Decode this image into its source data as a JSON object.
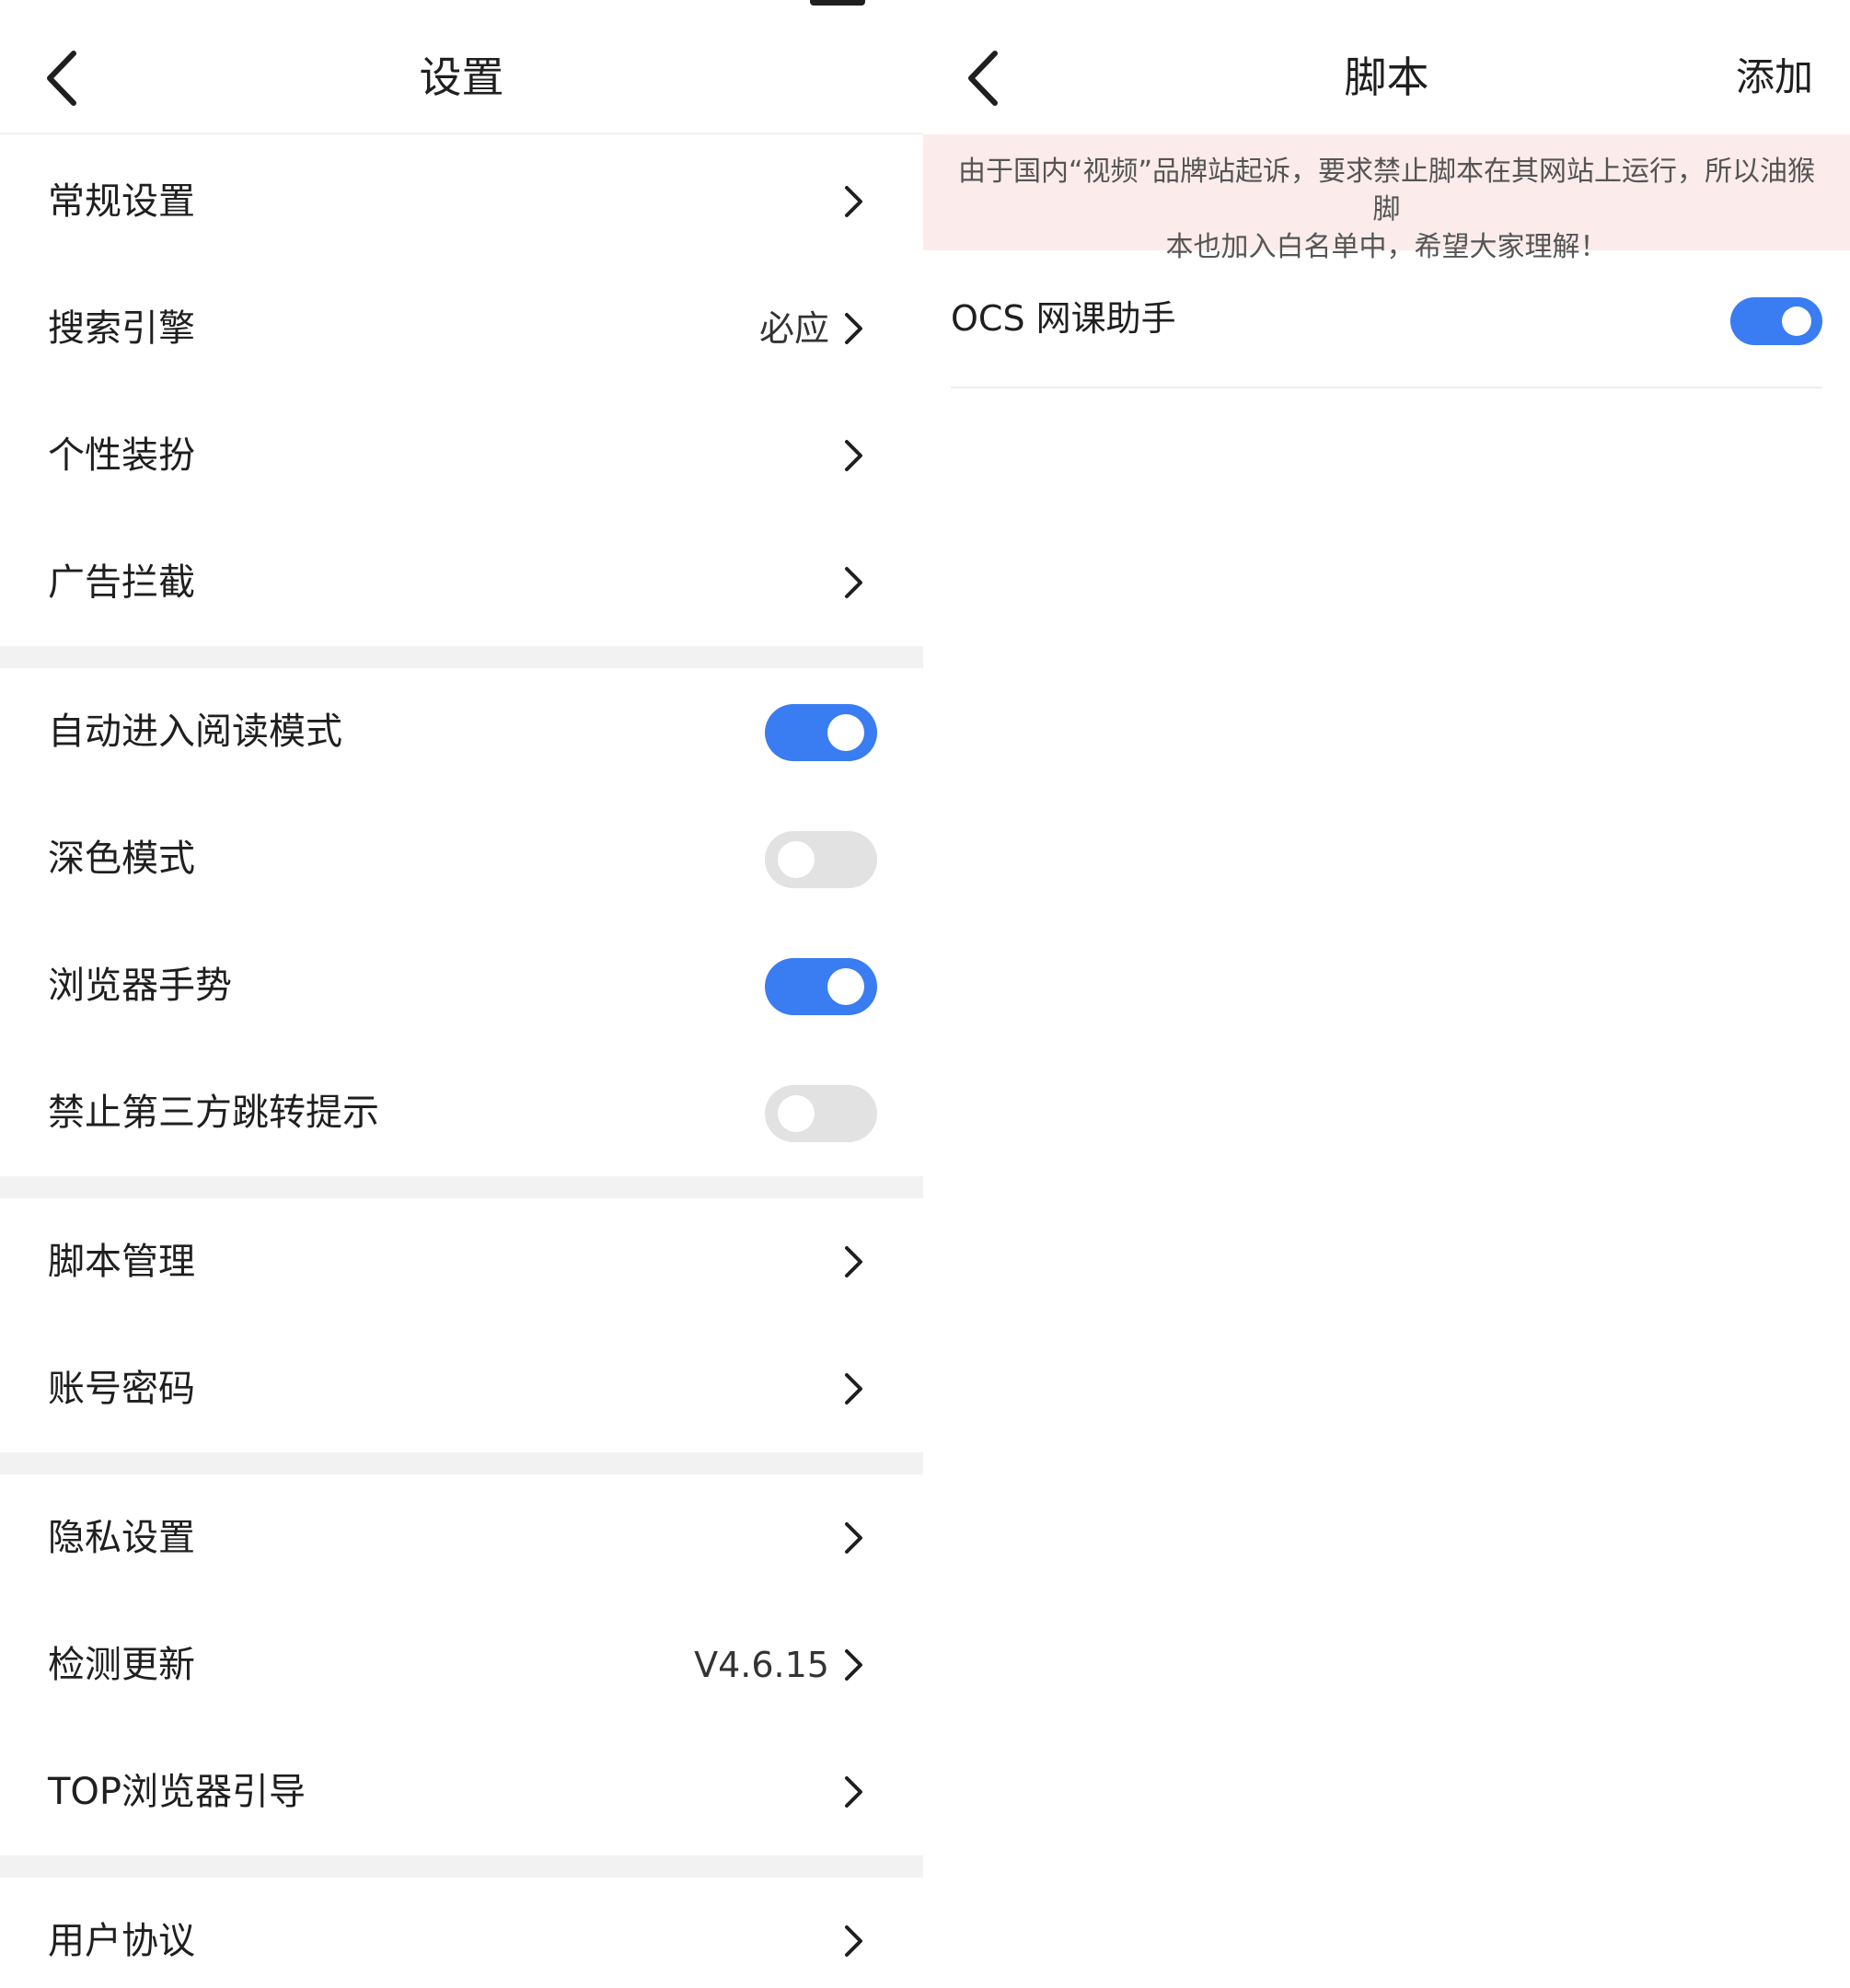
{
  "settings": {
    "title": "设置",
    "groups": [
      [
        {
          "label": "常规设置",
          "type": "nav"
        },
        {
          "label": "搜索引擎",
          "type": "nav",
          "value": "必应"
        },
        {
          "label": "个性装扮",
          "type": "nav"
        },
        {
          "label": "广告拦截",
          "type": "nav"
        }
      ],
      [
        {
          "label": "自动进入阅读模式",
          "type": "toggle",
          "on": true
        },
        {
          "label": "深色模式",
          "type": "toggle",
          "on": false
        },
        {
          "label": "浏览器手势",
          "type": "toggle",
          "on": true
        },
        {
          "label": "禁止第三方跳转提示",
          "type": "toggle",
          "on": false
        }
      ],
      [
        {
          "label": "脚本管理",
          "type": "nav"
        },
        {
          "label": "账号密码",
          "type": "nav"
        }
      ],
      [
        {
          "label": "隐私设置",
          "type": "nav"
        },
        {
          "label": "检测更新",
          "type": "nav",
          "value": "V4.6.15"
        },
        {
          "label": "TOP浏览器引导",
          "type": "nav"
        }
      ],
      [
        {
          "label": "用户协议",
          "type": "nav"
        }
      ]
    ]
  },
  "scripts": {
    "title": "脚本",
    "add_label": "添加",
    "notice_line1": "由于国内“视频”品牌站起诉，要求禁止脚本在其网站上运行，所以油猴脚",
    "notice_line2": "本也加入白名单中，希望大家理解！",
    "items": [
      {
        "name": "OCS 网课助手",
        "enabled": true
      }
    ]
  },
  "icons": {
    "back": "chevron-left-icon",
    "forward": "chevron-right-icon"
  },
  "colors": {
    "accent": "#3a7cf2",
    "toggle_off": "#e2e2e2",
    "notice_bg": "#fbeceb",
    "section_gap": "#f2f2f2"
  }
}
